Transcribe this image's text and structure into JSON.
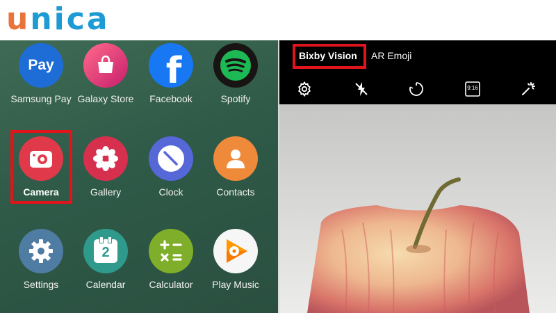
{
  "header": {
    "logo_first": "u",
    "logo_rest": "nica"
  },
  "home_screen": {
    "apps": [
      {
        "label": "Samsung Pay",
        "icon": "samsung-pay-icon",
        "glyph": "Pay",
        "color": "#1e6cd6"
      },
      {
        "label": "Galaxy Store",
        "icon": "galaxy-store-icon",
        "color": "#e93a6f"
      },
      {
        "label": "Facebook",
        "icon": "facebook-icon",
        "glyph": "f",
        "color": "#1877f2"
      },
      {
        "label": "Spotify",
        "icon": "spotify-icon",
        "color": "#1db954"
      },
      {
        "label": "Camera",
        "icon": "camera-icon",
        "color": "#e03a4a"
      },
      {
        "label": "Gallery",
        "icon": "gallery-icon",
        "color": "#d7304f"
      },
      {
        "label": "Clock",
        "icon": "clock-icon",
        "color": "#5667d8"
      },
      {
        "label": "Contacts",
        "icon": "contacts-icon",
        "color": "#ee8a3a"
      },
      {
        "label": "Settings",
        "icon": "settings-icon",
        "color": "#4f7ca3"
      },
      {
        "label": "Calendar",
        "icon": "calendar-icon",
        "glyph": "2",
        "color": "#2f9a8c"
      },
      {
        "label": "Calculator",
        "icon": "calculator-icon",
        "color": "#7fae2a"
      },
      {
        "label": "Play Music",
        "icon": "play-music-icon",
        "color": "#f6f6f6"
      }
    ]
  },
  "camera": {
    "modes": [
      "Bixby Vision",
      "AR Emoji"
    ],
    "active_mode": "Bixby Vision",
    "toolbar_icons": [
      "settings-icon",
      "flash-off-icon",
      "timer-off-icon",
      "aspect-ratio-icon",
      "filter-effects-icon"
    ],
    "aspect_ratio": "9:16"
  },
  "colors": {
    "highlight": "#e0141b",
    "logo_orange": "#e8743b",
    "logo_blue": "#1d9bd4"
  }
}
